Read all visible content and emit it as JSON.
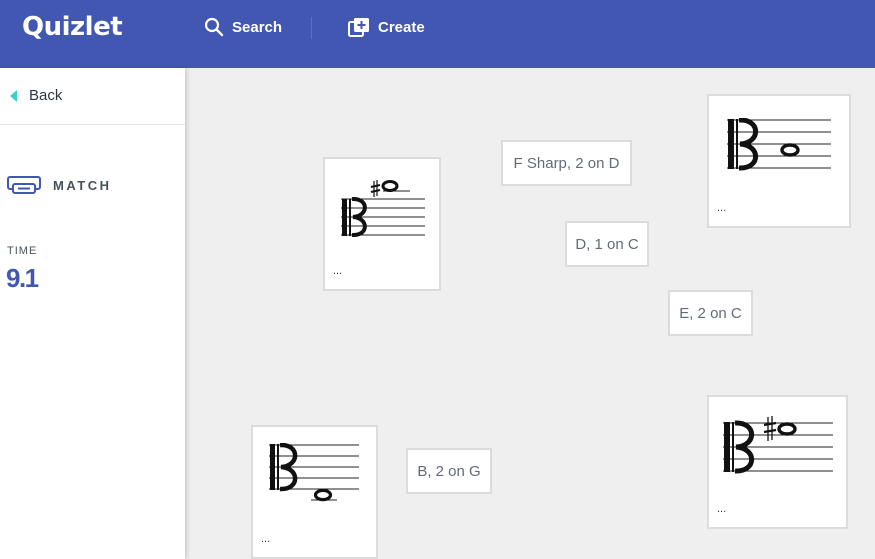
{
  "app": {
    "logo": "Quizlet"
  },
  "nav": {
    "search_label": "Search",
    "create_label": "Create"
  },
  "sidebar": {
    "back_label": "Back",
    "mode_label": "MATCH",
    "time_label": "TIME",
    "time_value": "9.1"
  },
  "cards": {
    "text": [
      "F Sharp, 2 on D",
      "D, 1 on C",
      "E, 2 on C",
      "B, 2 on G"
    ],
    "image_placeholder": "..."
  },
  "colors": {
    "brand": "#4257b2",
    "accent": "#3ccfcf",
    "board_bg": "#efefef"
  },
  "icons": [
    "search-icon",
    "create-icon",
    "back-arrow-icon",
    "match-icon",
    "alto-clef-icon",
    "sharp-icon",
    "whole-note-icon"
  ]
}
